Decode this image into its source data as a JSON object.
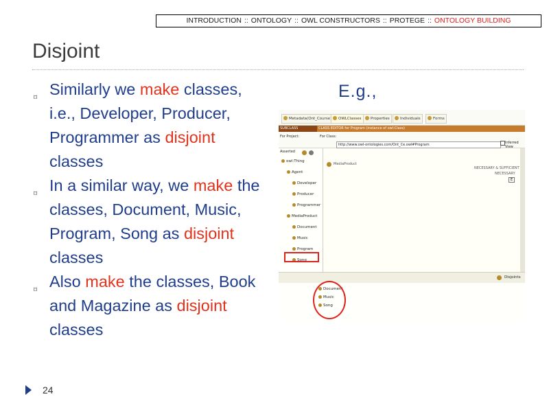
{
  "breadcrumb": {
    "sep": "::",
    "items": [
      "INTRODUCTION",
      "ONTOLOGY",
      "OWL CONSTRUCTORS",
      "PROTEGE",
      "ONTOLOGY BUILDING"
    ]
  },
  "slide": {
    "title": "Disjoint",
    "example_label": "E.g.,",
    "page_number": "24",
    "bullets": [
      {
        "segments": [
          {
            "text": "Similarly we ",
            "style": "blue"
          },
          {
            "text": "make",
            "style": "red"
          },
          {
            "text": " classes, i.e., Developer, Producer, Programmer as ",
            "style": "blue"
          },
          {
            "text": "disjoint",
            "style": "red"
          },
          {
            "text": " classes",
            "style": "blue"
          }
        ]
      },
      {
        "segments": [
          {
            "text": "In a similar way, we ",
            "style": "blue"
          },
          {
            "text": "make",
            "style": "red"
          },
          {
            "text": " the classes, Document, Music, Program, Song as ",
            "style": "blue"
          },
          {
            "text": "disjoint",
            "style": "red"
          },
          {
            "text": " classes",
            "style": "blue"
          }
        ]
      },
      {
        "segments": [
          {
            "text": "Also ",
            "style": "blue"
          },
          {
            "text": "make",
            "style": "red"
          },
          {
            "text": " the classes, Book and Magazine as ",
            "style": "blue"
          },
          {
            "text": "disjoint",
            "style": "red"
          },
          {
            "text": " classes",
            "style": "blue"
          }
        ]
      }
    ]
  },
  "screenshot": {
    "tabs": [
      "Metadata(Ont_Course)",
      "OWLClasses",
      "Properties",
      "Individuals",
      "Forms"
    ],
    "header_left": "SUBCLASS EXPLORER",
    "header_right": "CLASS EDITOR for Program   (instance of owl:Class)",
    "for_project": "For Project:",
    "for_class": "For Class:",
    "url": "http://www.owl-ontologies.com/Ont_Ce.owl#Program",
    "inferred_view": "Inferred View",
    "asserted": "Asserted",
    "tree": [
      {
        "label": "owl:Thing",
        "indent": 0
      },
      {
        "label": "Agent",
        "indent": 1
      },
      {
        "label": "Developer",
        "indent": 2
      },
      {
        "label": "Producer",
        "indent": 2
      },
      {
        "label": "Programmer",
        "indent": 2
      },
      {
        "label": "MediaProduct",
        "indent": 1
      },
      {
        "label": "Document",
        "indent": 2
      },
      {
        "label": "Music",
        "indent": 2
      },
      {
        "label": "Program",
        "indent": 2
      },
      {
        "label": "Song",
        "indent": 2
      }
    ],
    "annotation_value": "MediaProduct",
    "necessary_sufficient": "NECESSARY & SUFFICIENT",
    "necessary": "NECESSARY",
    "e_flag": "E",
    "disjoints_label": "Disjoints",
    "disjoints": [
      "Document",
      "Music",
      "Song"
    ],
    "colors": {
      "header": "#c77b2c",
      "header_dark": "#8a4614",
      "highlight": "#e0201b"
    }
  }
}
